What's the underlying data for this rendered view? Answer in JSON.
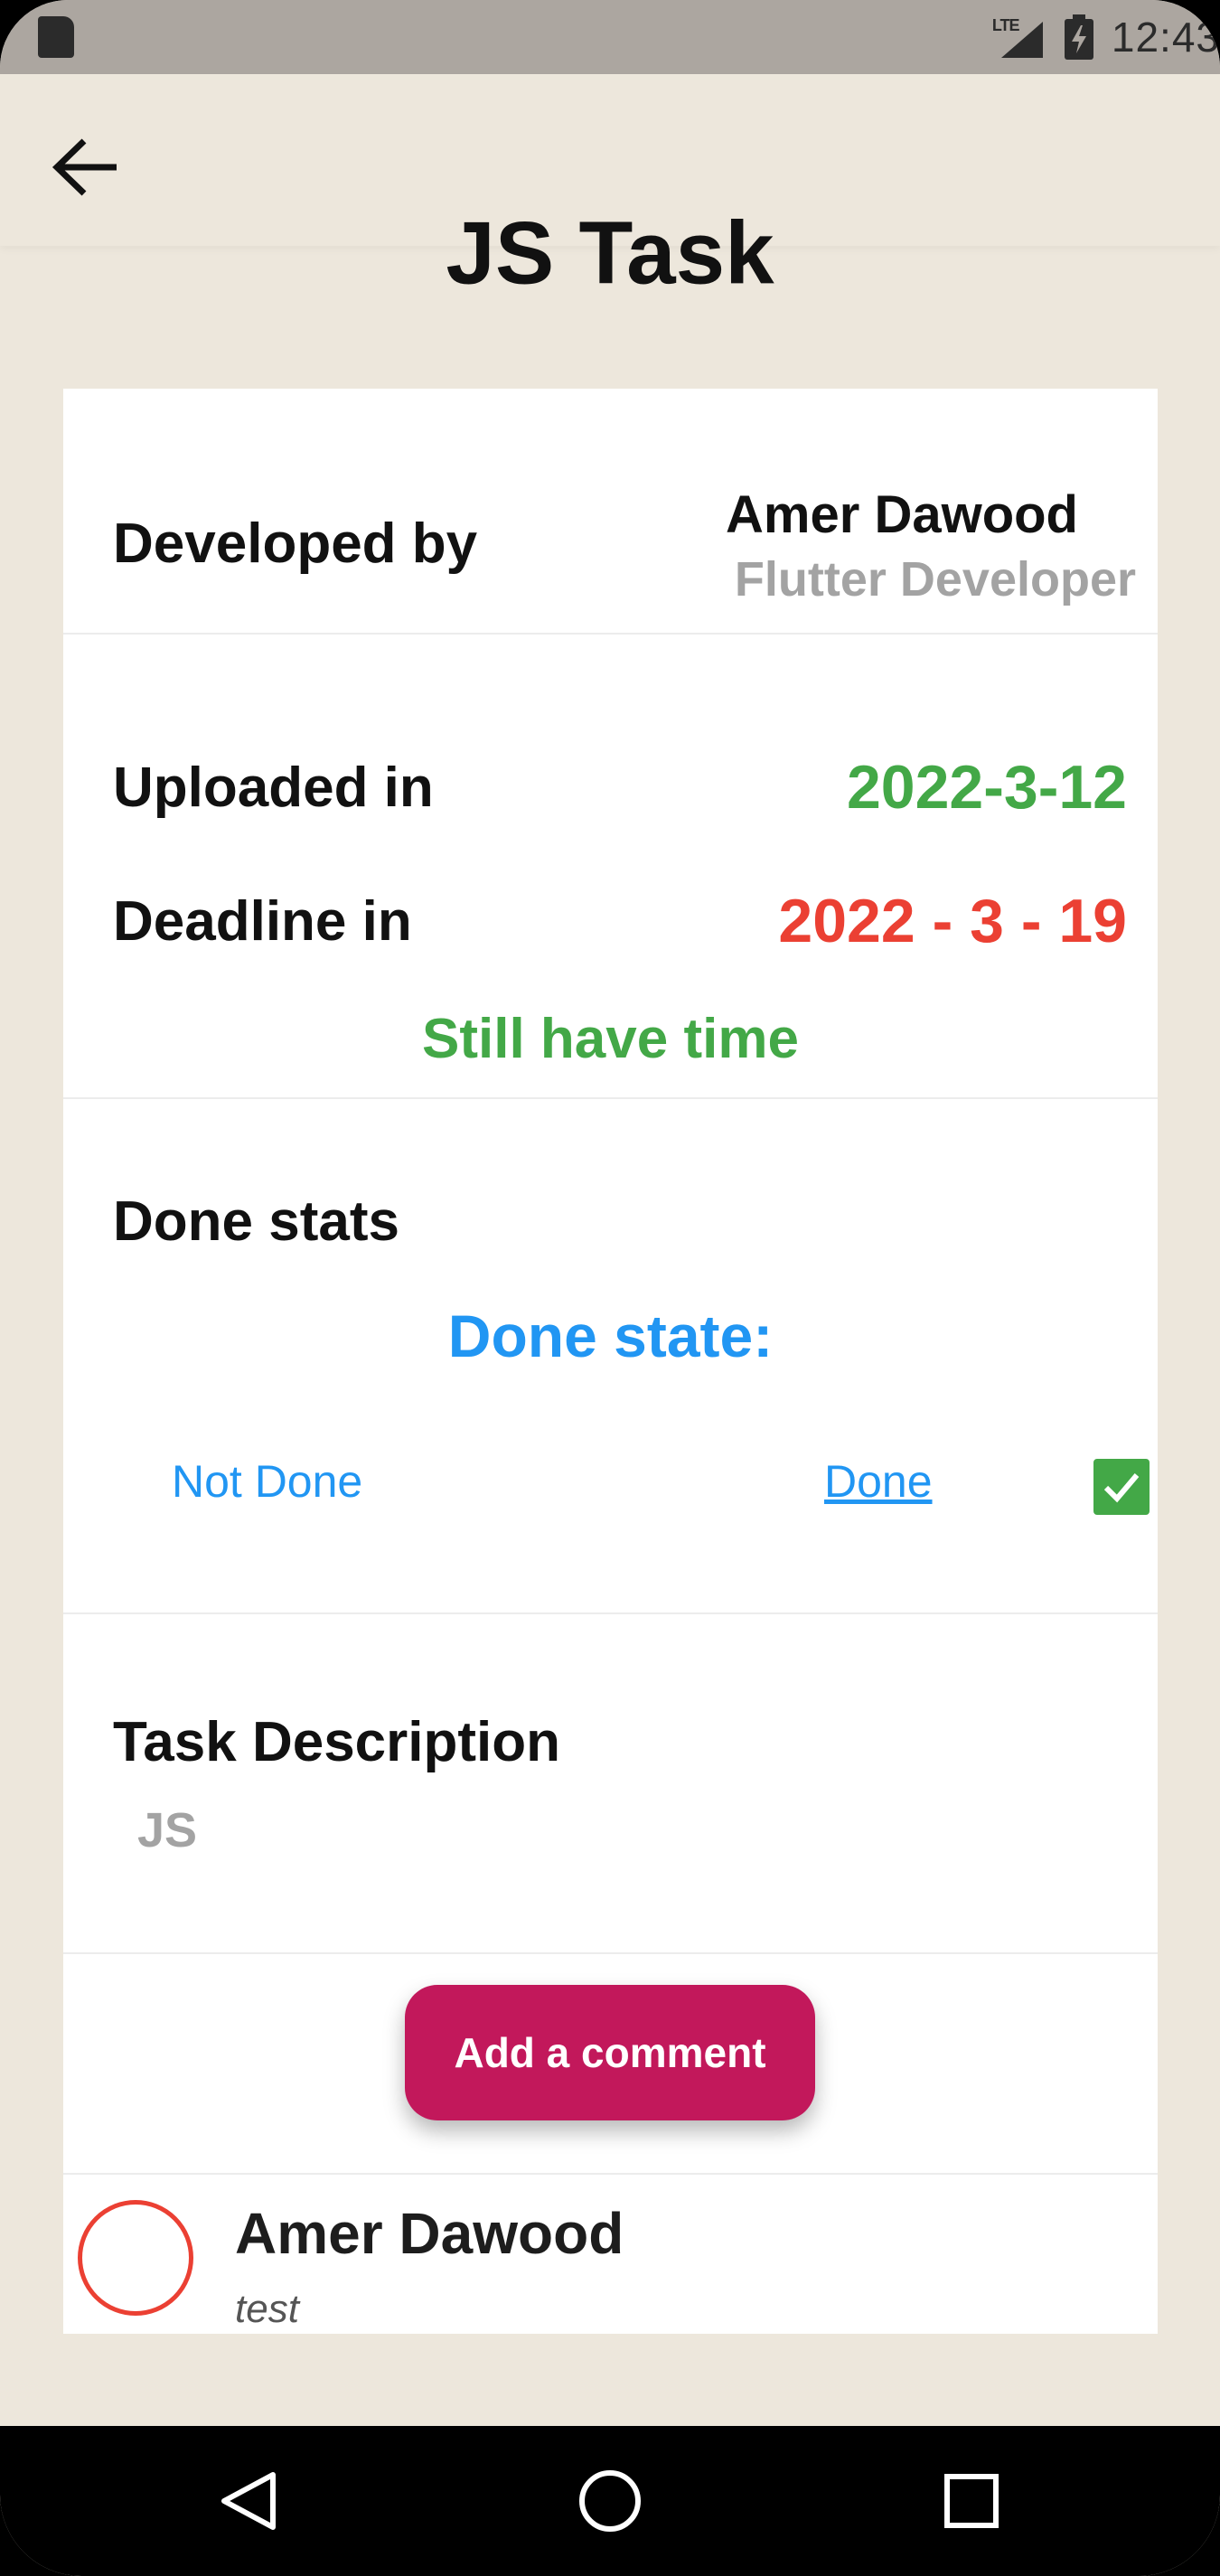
{
  "status_bar": {
    "network": "LTE",
    "time": "12:43"
  },
  "header": {
    "title": "JS Task",
    "back_icon": "arrow-left-icon"
  },
  "developer": {
    "label": "Developed by",
    "name": "Amer Dawood",
    "role": "Flutter Developer"
  },
  "dates": {
    "uploaded_label": "Uploaded in",
    "uploaded_value": "2022-3-12",
    "deadline_label": "Deadline in",
    "deadline_value": "2022 - 3 - 19",
    "status": "Still have time"
  },
  "done_stats": {
    "heading": "Done stats",
    "state_title": "Done state:",
    "not_done_label": "Not Done",
    "done_label": "Done",
    "done_checked": true
  },
  "description": {
    "heading": "Task Description",
    "text": "JS"
  },
  "comments": {
    "add_button_label": "Add a comment",
    "items": [
      {
        "author": "Amer Dawood",
        "text": "test"
      }
    ]
  },
  "colors": {
    "background": "#ede7dc",
    "green": "#43a847",
    "red": "#eb4033",
    "blue": "#2196f3",
    "accent_button": "#c2185b",
    "secondary_text": "#a3a3a3"
  },
  "nav_bar": {
    "icons": [
      "back-triangle-icon",
      "home-circle-icon",
      "recents-square-icon"
    ]
  }
}
